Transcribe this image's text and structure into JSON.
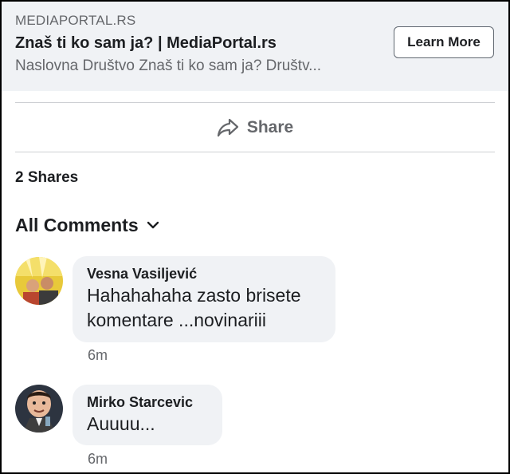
{
  "link_preview": {
    "domain": "MEDIAPORTAL.RS",
    "title": "Znaš ti ko sam ja? | MediaPortal.rs",
    "description": "Naslovna Društvo Znaš ti ko sam ja? Društv...",
    "button_label": "Learn More"
  },
  "actions": {
    "share_label": "Share",
    "share_icon": "share-arrow-icon"
  },
  "shares_count": "2 Shares",
  "comments_filter": {
    "label": "All Comments",
    "icon": "chevron-down-icon"
  },
  "comments": [
    {
      "author": "Vesna Vasiljević",
      "text_lines": [
        "Hahahahaha zasto brisete",
        "komentare ...novinariii"
      ],
      "time": "6m"
    },
    {
      "author": "Mirko Starcevic",
      "text_lines": [
        "Auuuu..."
      ],
      "time": "6m"
    }
  ],
  "colors": {
    "preview_bg": "#f0f2f5",
    "secondary_text": "#65676b",
    "primary_text": "#1c1e21",
    "bubble_bg": "#f0f2f5",
    "divider": "#ced0d4"
  }
}
